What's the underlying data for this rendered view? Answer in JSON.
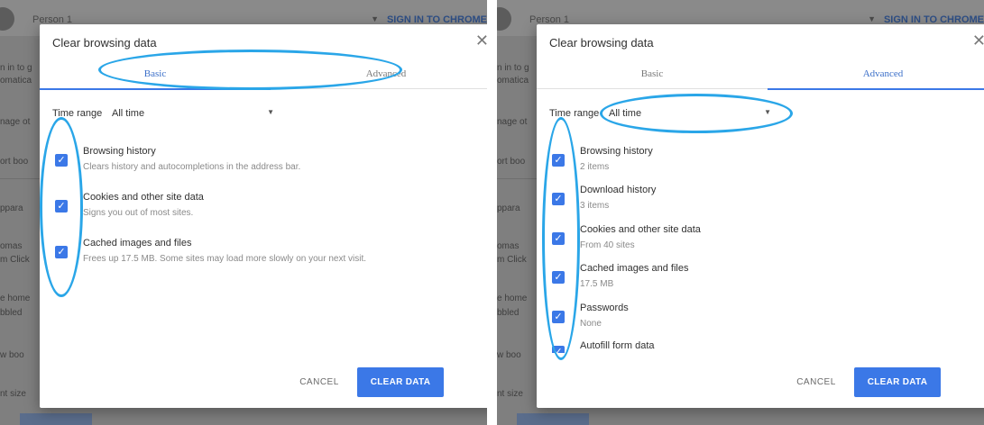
{
  "background": {
    "person_label": "Person 1",
    "sync_link": "SIGN IN TO CHROME",
    "side_fragments_left": [
      "n in to g",
      "omatica",
      "nage ot",
      "ort boo",
      "",
      "ppara",
      "omas",
      "m Click",
      "e home",
      "bbled",
      "w boo",
      "nt size"
    ],
    "side_fragments_right": [
      "n in to g",
      "omatica",
      "nage ot",
      "ort boo",
      "",
      "ppara",
      "omas",
      "m Click",
      "e home",
      "bbled",
      "w boo",
      "nt size"
    ]
  },
  "dialog_basic": {
    "title": "Clear browsing data",
    "close_glyph": "✕",
    "tabs": [
      {
        "label": "Basic",
        "active": true
      },
      {
        "label": "Advanced",
        "active": false
      }
    ],
    "time_range": {
      "label": "Time range",
      "value": "All time",
      "arrow": "▼"
    },
    "items": [
      {
        "title": "Browsing history",
        "desc": "Clears history and autocompletions in the address bar.",
        "checked": true
      },
      {
        "title": "Cookies and other site data",
        "desc": "Signs you out of most sites.",
        "checked": true
      },
      {
        "title": "Cached images and files",
        "desc": "Frees up 17.5 MB. Some sites may load more slowly on your next visit.",
        "checked": true
      }
    ],
    "cancel_label": "CANCEL",
    "clear_label": "CLEAR DATA"
  },
  "dialog_advanced": {
    "title": "Clear browsing data",
    "close_glyph": "✕",
    "tabs": [
      {
        "label": "Basic",
        "active": false
      },
      {
        "label": "Advanced",
        "active": true
      }
    ],
    "time_range": {
      "label": "Time range",
      "value": "All time",
      "arrow": "▼"
    },
    "items": [
      {
        "title": "Browsing history",
        "desc": "2 items",
        "checked": true
      },
      {
        "title": "Download history",
        "desc": "3 items",
        "checked": true
      },
      {
        "title": "Cookies and other site data",
        "desc": "From 40 sites",
        "checked": true
      },
      {
        "title": "Cached images and files",
        "desc": "17.5 MB",
        "checked": true
      },
      {
        "title": "Passwords",
        "desc": "None",
        "checked": true
      },
      {
        "title": "Autofill form data",
        "desc": "",
        "checked": true
      }
    ],
    "cancel_label": "CANCEL",
    "clear_label": "CLEAR DATA"
  },
  "colors": {
    "accent": "#3b78e7",
    "highlight": "#2aa6e8",
    "overlay": "#7d7d7d"
  },
  "icons": {
    "checkbox": "checkmark-icon",
    "close": "close-icon",
    "dropdown": "chevron-down-icon",
    "scroll_up": "scroll-up-arrow-icon",
    "scroll_down": "scroll-down-arrow-icon"
  }
}
